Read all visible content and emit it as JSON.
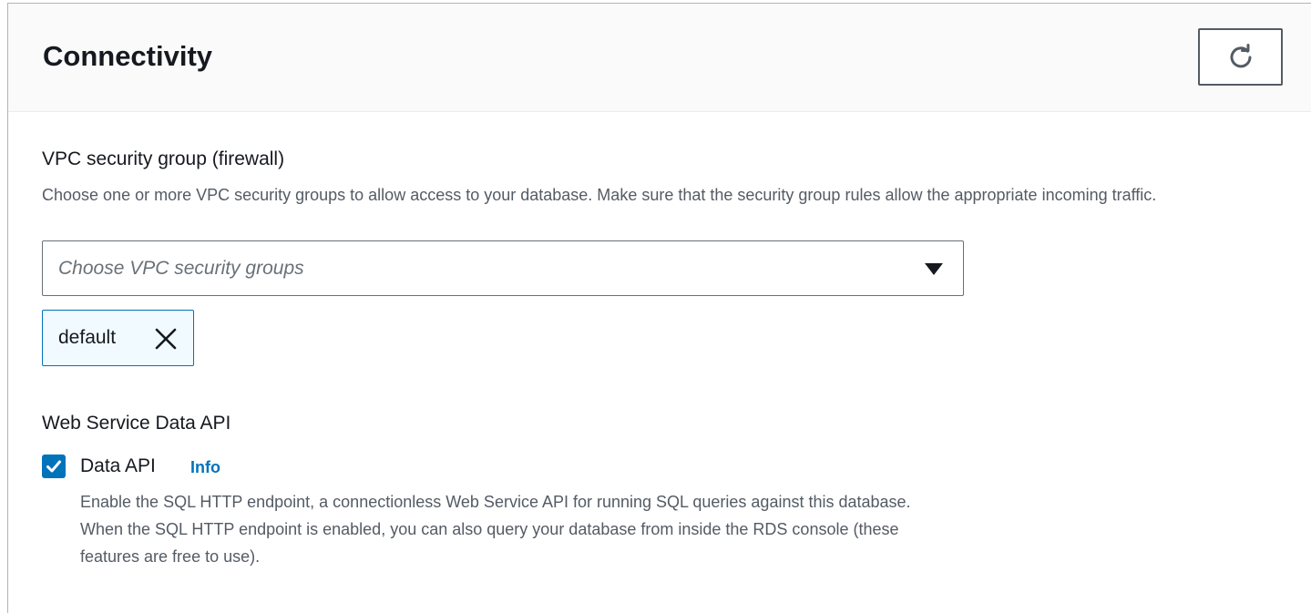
{
  "panel": {
    "title": "Connectivity",
    "refresh_icon": "refresh-icon"
  },
  "security_group": {
    "label": "VPC security group (firewall)",
    "description": "Choose one or more VPC security groups to allow access to your database. Make sure that the security group rules allow the appropriate incoming traffic.",
    "placeholder": "Choose VPC security groups",
    "caret_icon": "caret-down-icon",
    "selected_tokens": [
      {
        "label": "default",
        "remove_icon": "close-icon"
      }
    ]
  },
  "data_api": {
    "section_label": "Web Service Data API",
    "checkbox_label": "Data API",
    "checked": true,
    "info_link": "Info",
    "description": "Enable the SQL HTTP endpoint, a connectionless Web Service API for running SQL queries against this database. When the SQL HTTP endpoint is enabled, you can also query your database from inside the RDS console (these features are free to use)."
  },
  "colors": {
    "accent": "#0073bb",
    "text": "#16191f",
    "secondary_text": "#545b64",
    "header_bg": "#fafafa",
    "token_bg": "#f1faff"
  }
}
